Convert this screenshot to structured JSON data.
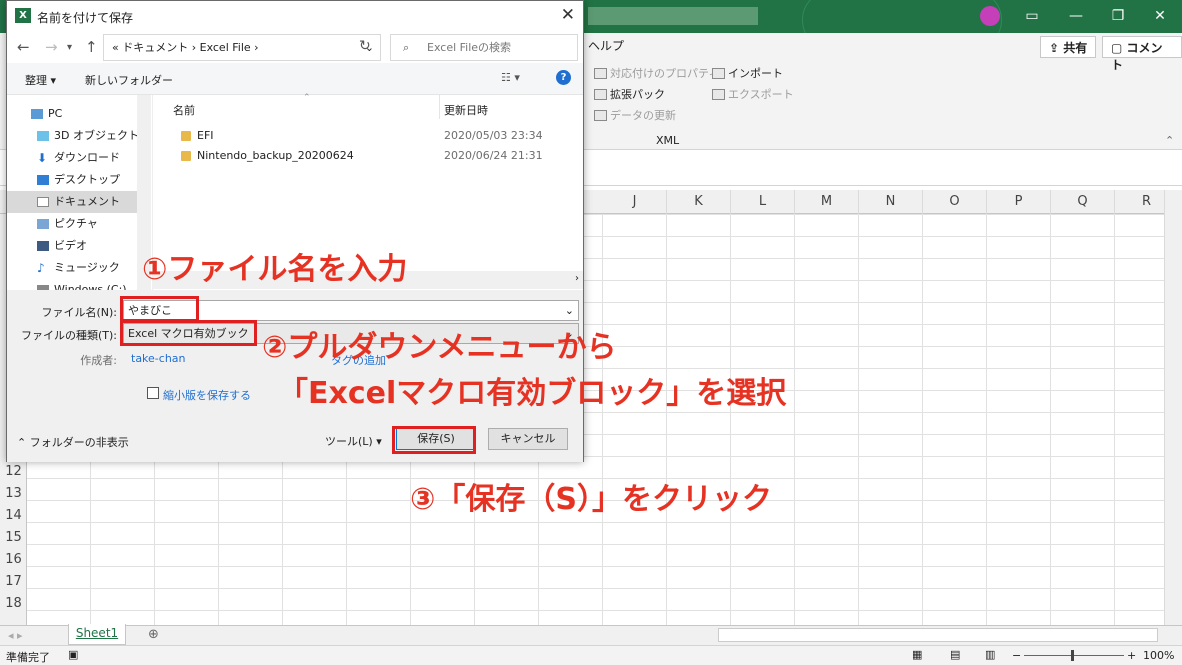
{
  "excel": {
    "ribbon": {
      "help": "ヘルプ",
      "share": "共有",
      "comment": "コメント",
      "items": [
        "対応付けのプロパティ",
        "拡張パック",
        "データの更新",
        "インポート",
        "エクスポート"
      ],
      "group": "XML"
    },
    "columns": [
      "J",
      "K",
      "L",
      "M",
      "N",
      "O",
      "P",
      "Q",
      "R"
    ],
    "rows": [
      "12",
      "13",
      "14",
      "15",
      "16",
      "17",
      "18"
    ],
    "sheet_tab": "Sheet1",
    "status": "準備完了",
    "zoom": "100%"
  },
  "dialog": {
    "title": "名前を付けて保存",
    "address": "« ドキュメント › Excel File ›",
    "search_placeholder": "Excel Fileの検索",
    "organize": "整理 ▾",
    "new_folder": "新しいフォルダー",
    "nav": [
      "PC",
      "3D オブジェクト",
      "ダウンロード",
      "デスクトップ",
      "ドキュメント",
      "ピクチャ",
      "ビデオ",
      "ミュージック",
      "Windows (C:)"
    ],
    "columns": {
      "name": "名前",
      "date": "更新日時"
    },
    "files": [
      {
        "name": "EFI",
        "date": "2020/05/03 23:34"
      },
      {
        "name": "Nintendo_backup_20200624",
        "date": "2020/06/24 21:31"
      }
    ],
    "filename_label": "ファイル名(N):",
    "filename_value": "やまびこ",
    "filetype_label": "ファイルの種類(T):",
    "filetype_value": "Excel マクロ有効ブック",
    "author_label": "作成者:",
    "author_value": "take-chan",
    "tag_link": "タグの追加",
    "thumbnail": "縮小版を保存する",
    "hide_folders": "フォルダーの非表示",
    "tools": "ツール(L)",
    "save": "保存(S)",
    "cancel": "キャンセル"
  },
  "annotations": {
    "step1": "①ファイル名を入力",
    "step2a": "②プルダウンメニューから",
    "step2b": "「Excelマクロ有効ブロック」を選択",
    "step3": "③「保存（S）」をクリック"
  },
  "colors": {
    "excel_green": "#217346",
    "annotation_red": "#e53223"
  }
}
